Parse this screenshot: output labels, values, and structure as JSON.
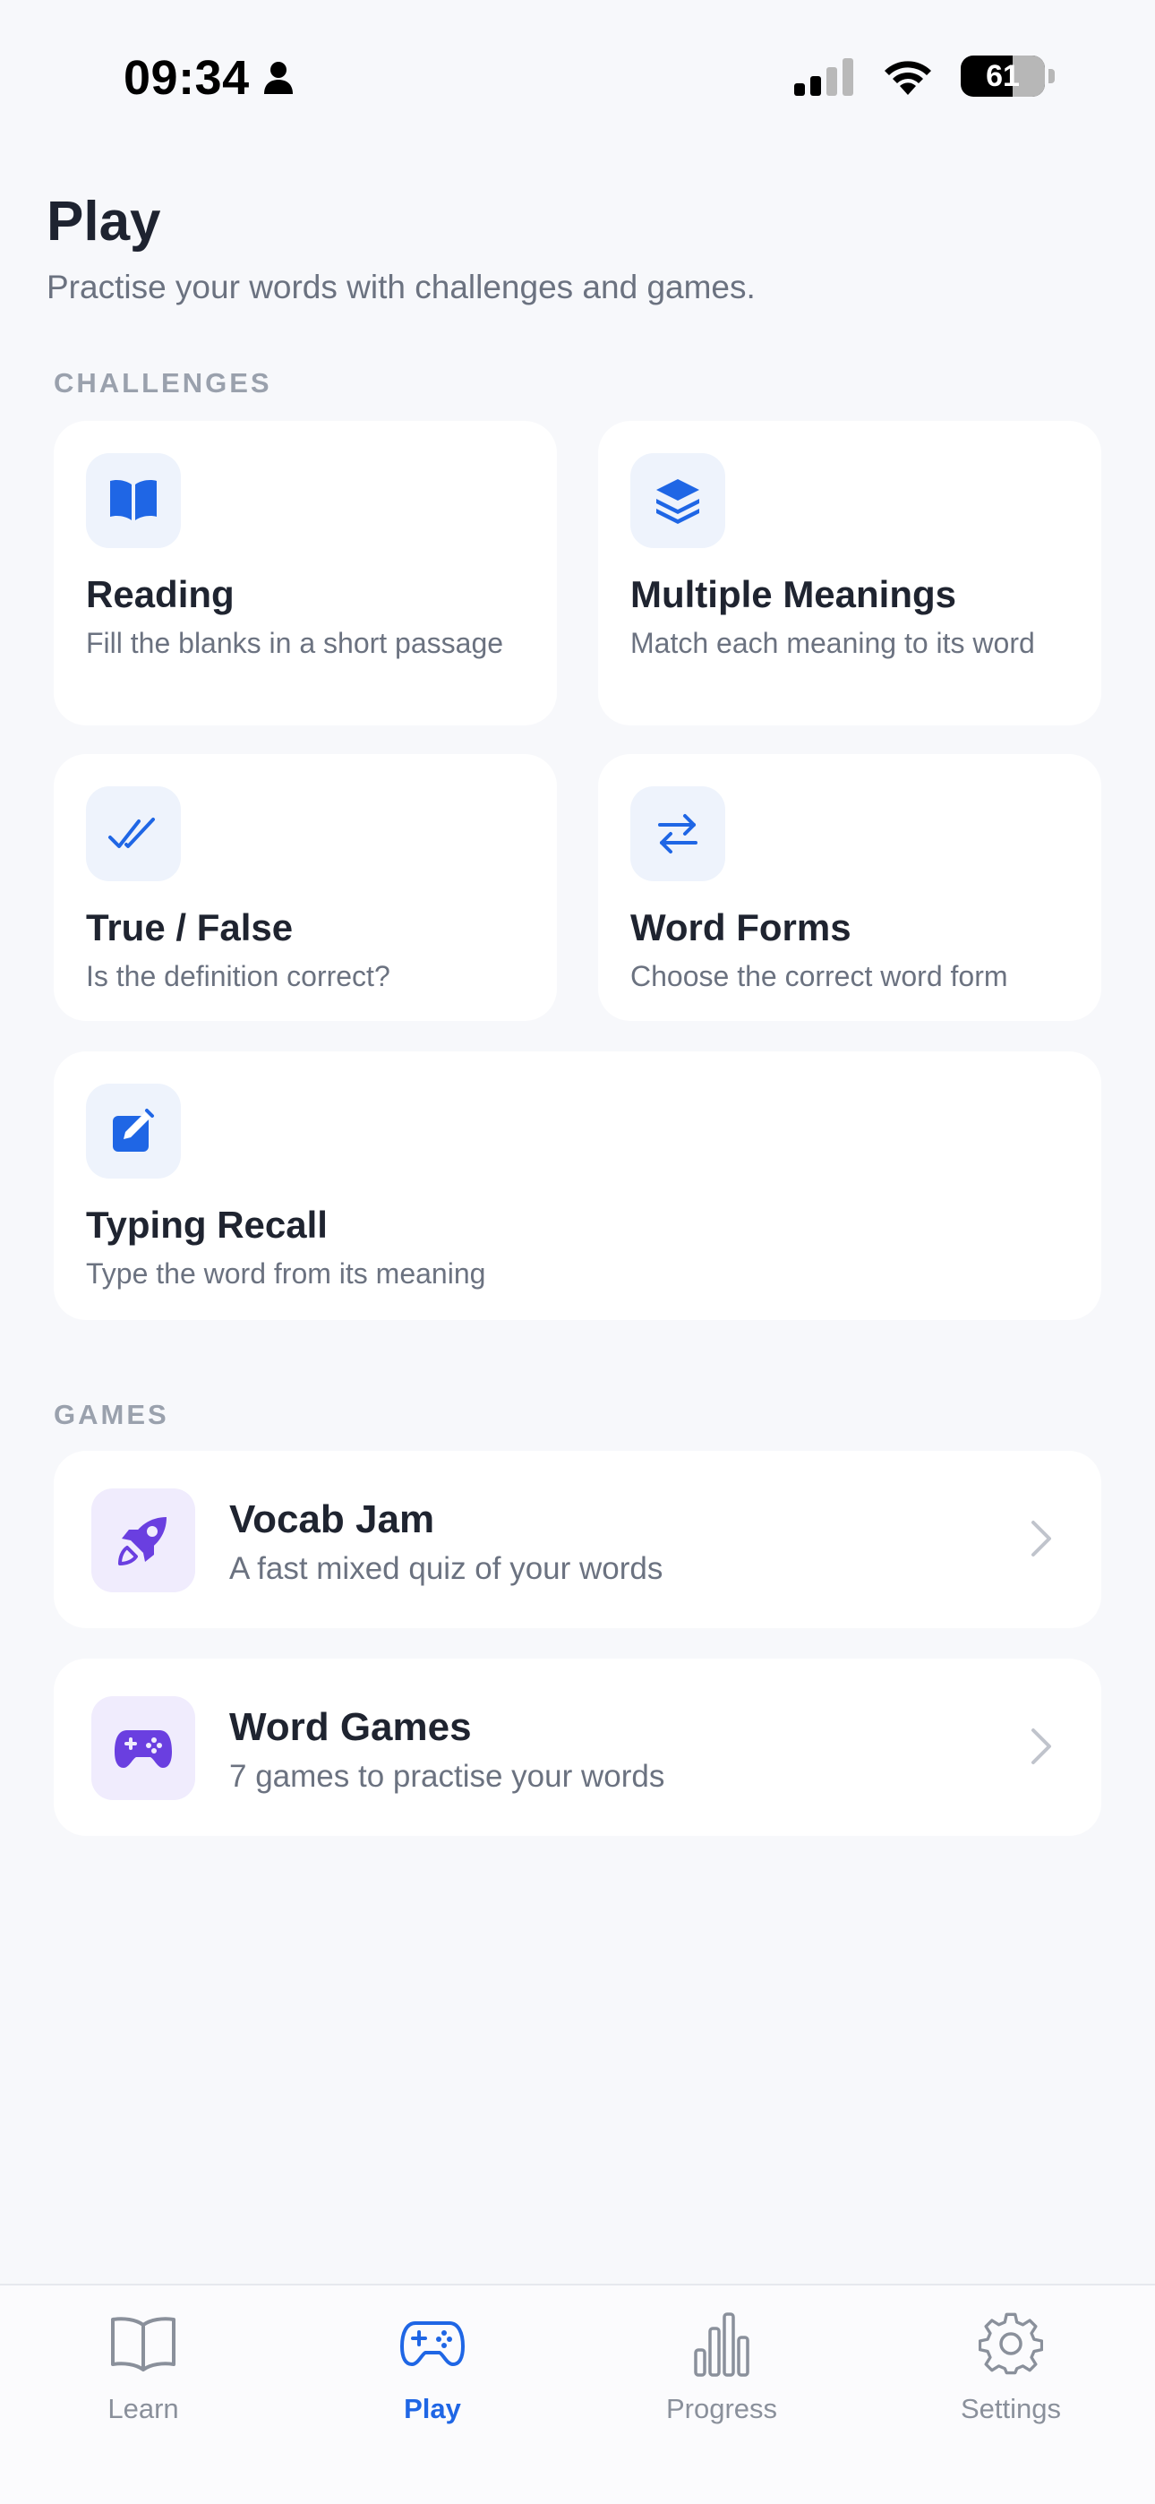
{
  "status_bar": {
    "time": "09:34",
    "battery": "61"
  },
  "header": {
    "title": "Play",
    "subtitle": "Practise your words with challenges and games."
  },
  "challenges": {
    "label": "CHALLENGES",
    "items": [
      {
        "title": "Reading",
        "desc": "Fill the blanks in a short passage",
        "icon": "book-icon"
      },
      {
        "title": "Multiple Meanings",
        "desc": "Match each meaning to its word",
        "icon": "layers-icon"
      },
      {
        "title": "True / False",
        "desc": "Is the definition correct?",
        "icon": "double-check-icon"
      },
      {
        "title": "Word Forms",
        "desc": "Choose the correct word form",
        "icon": "swap-arrows-icon"
      },
      {
        "title": "Typing Recall",
        "desc": "Type the word from its meaning",
        "icon": "edit-icon"
      }
    ]
  },
  "games": {
    "label": "GAMES",
    "items": [
      {
        "title": "Vocab Jam",
        "desc": "A fast mixed quiz of your words",
        "icon": "rocket-icon"
      },
      {
        "title": "Word Games",
        "desc": "7 games to practise your words",
        "icon": "gamepad-icon"
      }
    ]
  },
  "tabs": [
    {
      "label": "Learn",
      "icon": "book-open-icon",
      "active": false
    },
    {
      "label": "Play",
      "icon": "gamepad-icon",
      "active": true
    },
    {
      "label": "Progress",
      "icon": "bar-chart-icon",
      "active": false
    },
    {
      "label": "Settings",
      "icon": "gear-icon",
      "active": false
    }
  ],
  "colors": {
    "accent": "#1f66e5",
    "games_accent": "#6a3fe0",
    "background": "#f7f8fb",
    "card": "#ffffff"
  }
}
